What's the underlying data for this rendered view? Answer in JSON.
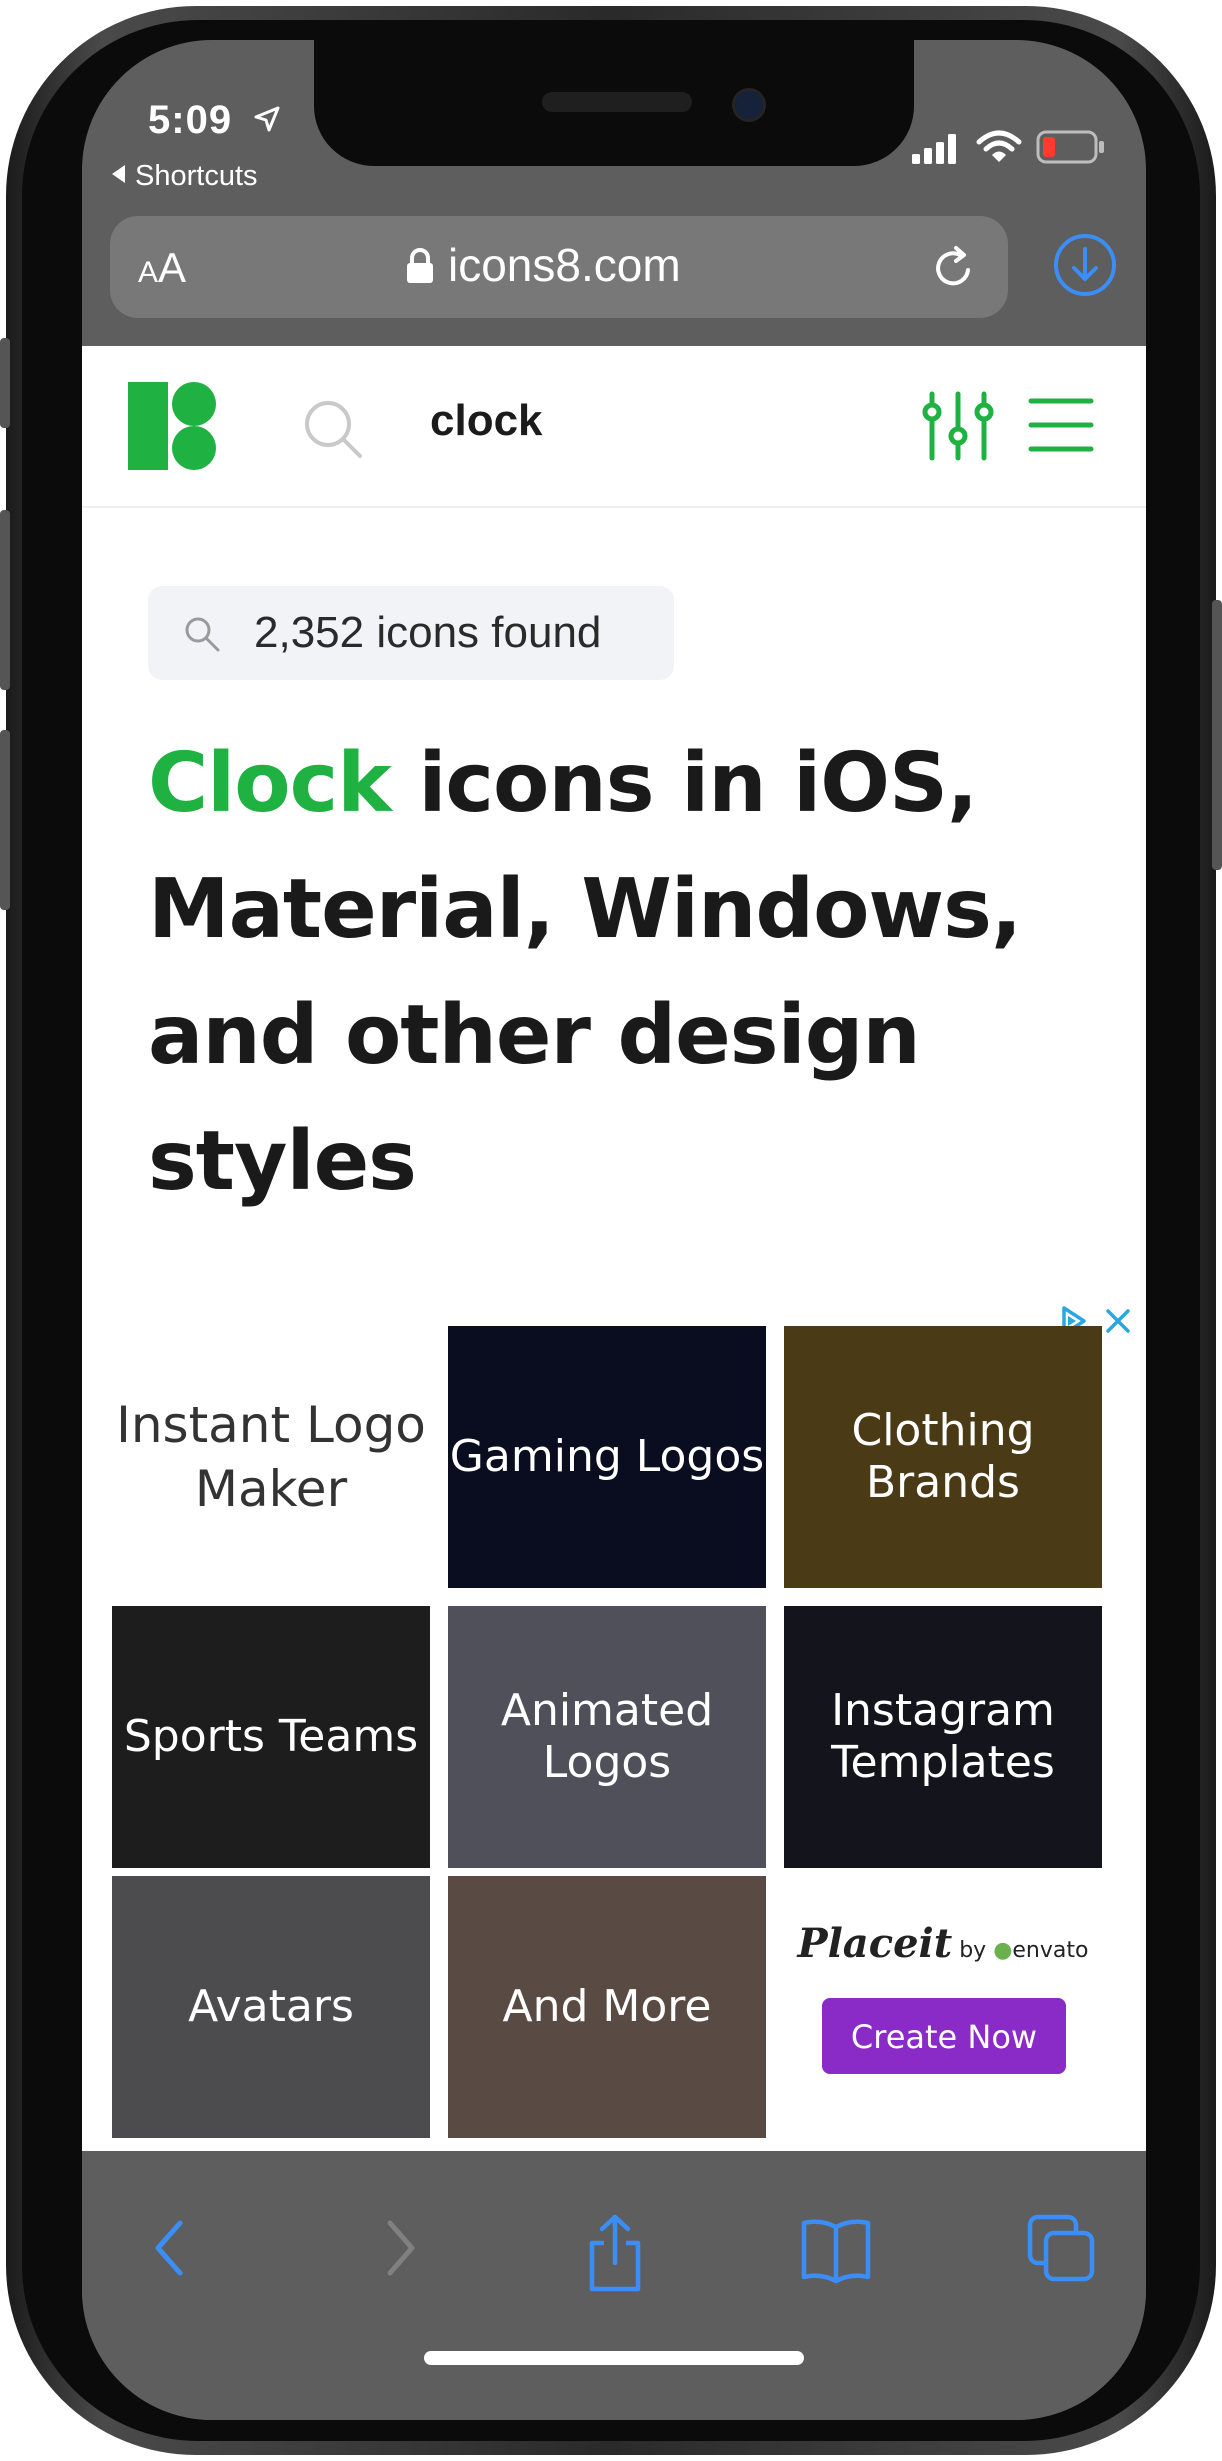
{
  "status_bar": {
    "time": "5:09",
    "back_app": "Shortcuts"
  },
  "address_bar": {
    "text_size_small": "A",
    "text_size_large": "A",
    "domain": "icons8.com"
  },
  "site": {
    "search_query": "clock",
    "results_count": "2,352 icons found",
    "heading_highlight": "Clock",
    "heading_rest": " icons in iOS, Material, Windows, and other design styles",
    "accent_color": "#1fb141"
  },
  "ad": {
    "tiles": [
      {
        "label": "Instant Logo Maker"
      },
      {
        "label": "Gaming Logos"
      },
      {
        "label": "Clothing Brands"
      },
      {
        "label": "Sports Teams"
      },
      {
        "label": "Animated Logos"
      },
      {
        "label": "Instagram Templates"
      },
      {
        "label": "Avatars"
      },
      {
        "label": "And More"
      }
    ],
    "brand": "Placeit",
    "brand_by": "by",
    "brand_partner": "envato",
    "cta": "Create Now",
    "cta_color": "#8a2bc8"
  },
  "toolbar": {
    "items": [
      "back-icon",
      "forward-icon",
      "share-icon",
      "bookmarks-icon",
      "tabs-icon"
    ],
    "icon_color": "#3a8ef6"
  }
}
